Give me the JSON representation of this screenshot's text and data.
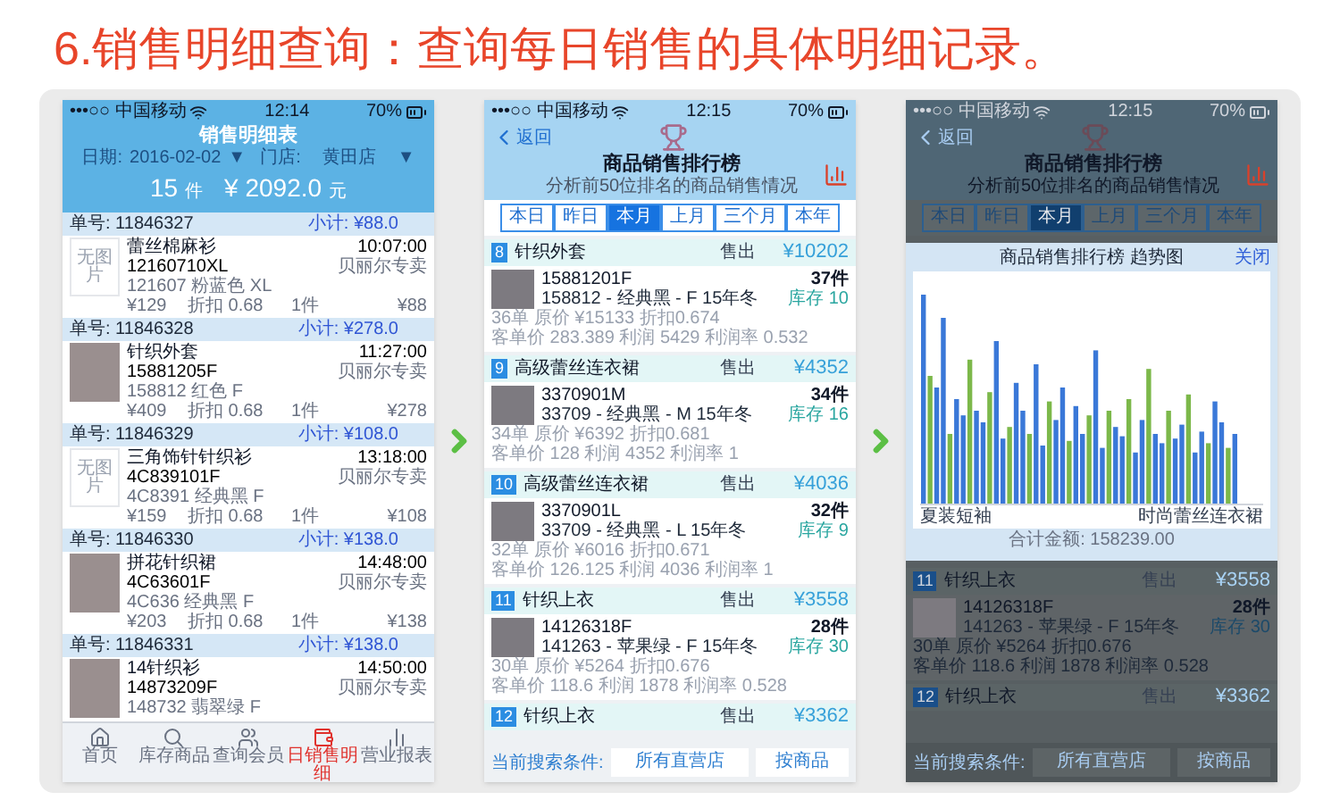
{
  "heading": "6.销售明细查询：查询每日销售的具体明细记录。",
  "sales_detail_screen": {
    "status": {
      "carrier": "•••○○ 中国移动",
      "time": "12:14",
      "battery": "70%"
    },
    "title": "销售明细表",
    "date_label": "日期:",
    "date": "2016-02-02",
    "date_caret": "▼",
    "store_label": "门店:",
    "store": "黄田店",
    "store_caret": "▼",
    "total_count": "15",
    "count_unit": "件",
    "total_amount": "¥ 2092.0",
    "amount_unit": "元",
    "orders": [
      {
        "order_no": "单号: 11846327",
        "subtotal": "小计: ¥88.0",
        "has_photo": false,
        "no_image": "无图片",
        "name": "蕾丝棉麻衫",
        "code": "12160710XL",
        "variant": "121607 粉蓝色 XL",
        "price": "¥129",
        "discount": "折扣 0.68",
        "qty": "1件",
        "amount": "¥88",
        "time": "10:07:00",
        "store": "贝丽尔专卖"
      },
      {
        "order_no": "单号: 11846328",
        "subtotal": "小计: ¥278.0",
        "has_photo": true,
        "name": "针织外套",
        "code": "15881205F",
        "variant": "158812 红色 F",
        "price": "¥409",
        "discount": "折扣 0.68",
        "qty": "1件",
        "amount": "¥278",
        "time": "11:27:00",
        "store": "贝丽尔专卖"
      },
      {
        "order_no": "单号: 11846329",
        "subtotal": "小计: ¥108.0",
        "has_photo": false,
        "no_image": "无图片",
        "name": "三角饰针针织衫",
        "code": "4C839101F",
        "variant": "4C8391 经典黑 F",
        "price": "¥159",
        "discount": "折扣 0.68",
        "qty": "1件",
        "amount": "¥108",
        "time": "13:18:00",
        "store": "贝丽尔专卖"
      },
      {
        "order_no": "单号: 11846330",
        "subtotal": "小计: ¥138.0",
        "has_photo": true,
        "name": "拼花针织裙",
        "code": "4C63601F",
        "variant": "4C636 经典黑 F",
        "price": "¥203",
        "discount": "折扣 0.68",
        "qty": "1件",
        "amount": "¥138",
        "time": "14:48:00",
        "store": "贝丽尔专卖"
      },
      {
        "order_no": "单号: 11846331",
        "subtotal": "小计: ¥138.0",
        "has_photo": true,
        "name": "14针织衫",
        "code": "14873209F",
        "variant": "148732 翡翠绿 F",
        "time": "14:50:00",
        "store": "贝丽尔专卖"
      }
    ],
    "tabbar": [
      {
        "kind": "home",
        "label": "首页",
        "selected": false
      },
      {
        "kind": "search",
        "label": "库存商品",
        "selected": false
      },
      {
        "kind": "members",
        "label": "查询会员",
        "selected": false
      },
      {
        "kind": "money",
        "label": "日销售明细",
        "selected": true
      },
      {
        "kind": "report",
        "label": "营业报表",
        "selected": false
      }
    ]
  },
  "ranking_screen": {
    "status": {
      "carrier": "•••○○ 中国移动",
      "time": "12:15",
      "battery": "70%"
    },
    "back": "返回",
    "title": "商品销售排行榜",
    "subtitle": "分析前50位排名的商品销售情况",
    "periods": [
      {
        "label": "本日",
        "selected": false
      },
      {
        "label": "昨日",
        "selected": false
      },
      {
        "label": "本月",
        "selected": true
      },
      {
        "label": "上月",
        "selected": false
      },
      {
        "label": "三个月",
        "selected": false
      },
      {
        "label": "本年",
        "selected": false
      }
    ],
    "items": [
      {
        "rank": "8",
        "name": "针织外套",
        "sold_label": "售出",
        "sales": "¥10202",
        "code": "15881201F",
        "variant": "158812 - 经典黑 - F  15年冬",
        "qty": "37件",
        "stock": "库存 10",
        "stats1": "36单   原价 ¥15133   折扣0.674",
        "stats2": "客单价 283.389  利润 5429  利润率 0.532"
      },
      {
        "rank": "9",
        "name": "高级蕾丝连衣裙",
        "sold_label": "售出",
        "sales": "¥4352",
        "code": "3370901M",
        "variant": "33709 - 经典黑 - M  15年冬",
        "qty": "34件",
        "stock": "库存 16",
        "stats1": "34单   原价 ¥6392   折扣0.681",
        "stats2": "客单价 128  利润 4352  利润率 1"
      },
      {
        "rank": "10",
        "name": "高级蕾丝连衣裙",
        "sold_label": "售出",
        "sales": "¥4036",
        "code": "3370901L",
        "variant": "33709 - 经典黑 - L  15年冬",
        "qty": "32件",
        "stock": "库存 9",
        "stats1": "32单   原价 ¥6016   折扣0.671",
        "stats2": "客单价 126.125  利润 4036  利润率 1"
      },
      {
        "rank": "11",
        "name": "针织上衣",
        "sold_label": "售出",
        "sales": "¥3558",
        "code": "14126318F",
        "variant": "141263 - 苹果绿 - F  15年冬",
        "qty": "28件",
        "stock": "库存 30",
        "stats1": "30单   原价 ¥5264   折扣0.676",
        "stats2": "客单价 118.6  利润 1878  利润率 0.528"
      },
      {
        "rank": "12",
        "name": "针织上衣",
        "sold_label": "售出",
        "sales": "¥3362"
      }
    ],
    "search_label": "当前搜索条件:",
    "store_filter": "所有直营店",
    "group_filter": "按商品"
  },
  "ranking_chart_screen": {
    "status": {
      "carrier": "•••○○ 中国移动",
      "time": "12:15",
      "battery": "70%"
    },
    "back": "返回",
    "title": "商品销售排行榜",
    "subtitle": "分析前50位排名的商品销售情况",
    "periods": [
      {
        "label": "本日",
        "selected": false
      },
      {
        "label": "昨日",
        "selected": false
      },
      {
        "label": "本月",
        "selected": true
      },
      {
        "label": "上月",
        "selected": false
      },
      {
        "label": "三个月",
        "selected": false
      },
      {
        "label": "本年",
        "selected": false
      }
    ],
    "dialog": {
      "title": "商品销售排行榜 趋势图",
      "close": "关闭",
      "first_label": "夏装短袖",
      "last_label": "时尚蕾丝连衣裙",
      "total": "合计金额:  158239.00"
    },
    "items": [
      {
        "rank": "11",
        "name": "针织上衣",
        "sold_label": "售出",
        "sales": "¥3558",
        "code": "14126318F",
        "variant": "141263 - 苹果绿 - F  15年冬",
        "qty": "28件",
        "stock": "库存 30",
        "stats1": "30单   原价 ¥5264   折扣0.676",
        "stats2": "客单价 118.6  利润 1878  利润率 0.528"
      },
      {
        "rank": "12",
        "name": "针织上衣",
        "sold_label": "售出",
        "sales": "¥3362"
      }
    ],
    "search_label": "当前搜索条件:",
    "store_filter": "所有直营店",
    "group_filter": "按商品"
  }
}
